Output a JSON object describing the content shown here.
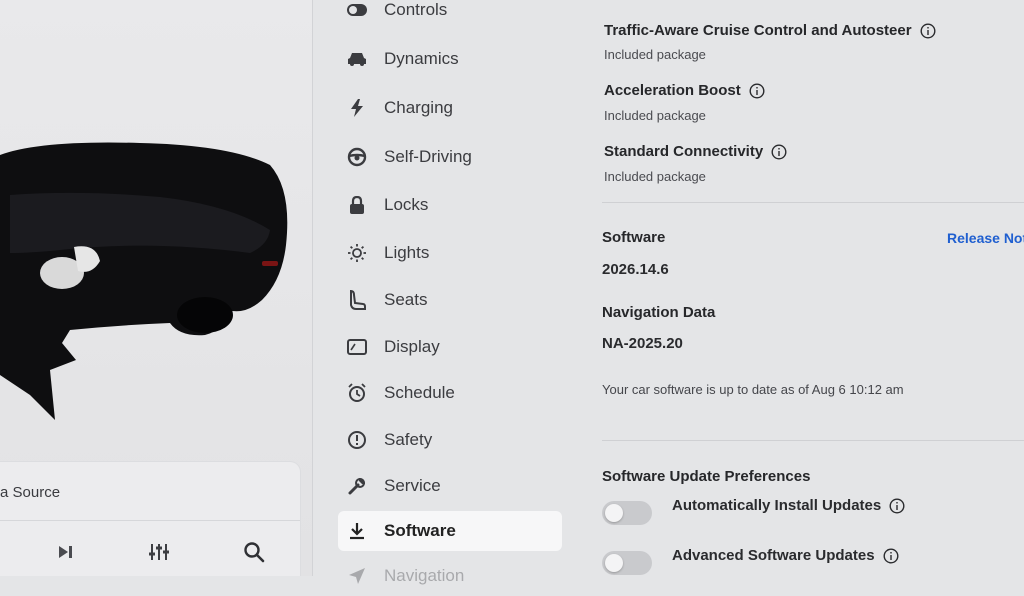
{
  "media": {
    "source_label": "a Source"
  },
  "menu": {
    "items": [
      {
        "label": "Controls",
        "icon": "toggle-icon"
      },
      {
        "label": "Dynamics",
        "icon": "car-icon"
      },
      {
        "label": "Charging",
        "icon": "bolt-icon"
      },
      {
        "label": "Self-Driving",
        "icon": "steering-wheel-icon"
      },
      {
        "label": "Locks",
        "icon": "lock-icon"
      },
      {
        "label": "Lights",
        "icon": "sun-icon"
      },
      {
        "label": "Seats",
        "icon": "seat-icon"
      },
      {
        "label": "Display",
        "icon": "display-icon"
      },
      {
        "label": "Schedule",
        "icon": "alarm-clock-icon"
      },
      {
        "label": "Safety",
        "icon": "alert-icon"
      },
      {
        "label": "Service",
        "icon": "wrench-icon"
      },
      {
        "label": "Software",
        "icon": "download-icon",
        "active": true
      },
      {
        "label": "Navigation",
        "icon": "navigation-icon"
      }
    ]
  },
  "features": [
    {
      "title": "Traffic-Aware Cruise Control and Autosteer",
      "subtitle": "Included package"
    },
    {
      "title": "Acceleration Boost",
      "subtitle": "Included package"
    },
    {
      "title": "Standard Connectivity",
      "subtitle": "Included package"
    }
  ],
  "software": {
    "label": "Software",
    "version": "2026.14.6",
    "release_notes_link": "Release Not",
    "nav_label": "Navigation Data",
    "nav_version": "NA-2025.20",
    "status": "Your car software is up to date as of Aug 6 10:12 am"
  },
  "preferences": {
    "title": "Software Update Preferences",
    "toggles": [
      {
        "label": "Automatically Install Updates",
        "on": false
      },
      {
        "label": "Advanced Software Updates",
        "on": false
      }
    ]
  },
  "colors": {
    "accent_link": "#1f5fd0",
    "background": "#e4e5e7",
    "active_item": "#f7f7f8"
  }
}
